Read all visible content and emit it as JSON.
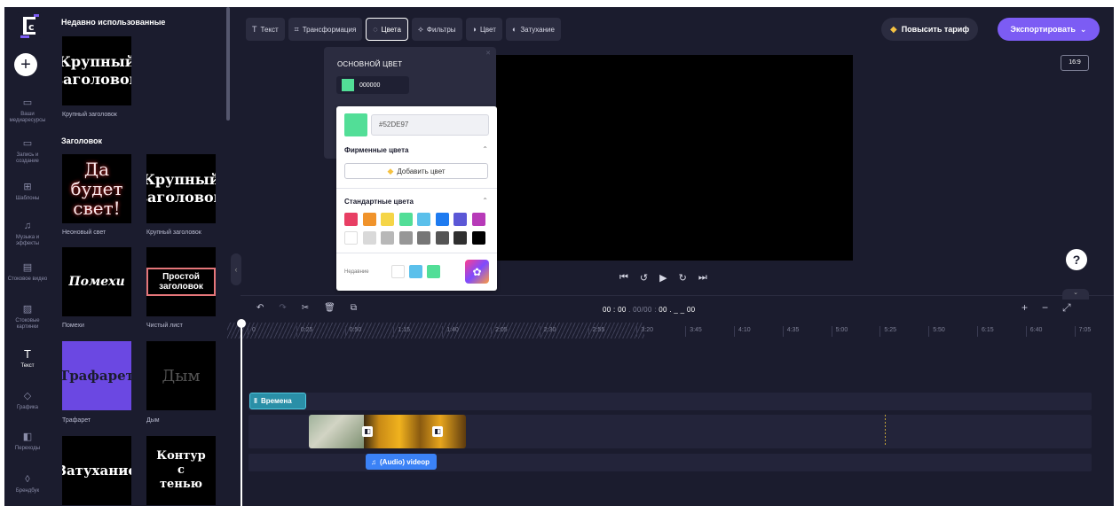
{
  "rail": {
    "items": [
      {
        "label": "Ваши медиаресурсы",
        "icon": "folder-icon"
      },
      {
        "label": "Запись и создание",
        "icon": "camera-icon"
      },
      {
        "label": "Шаблоны",
        "icon": "templates-icon"
      },
      {
        "label": "Музыка и эффекты",
        "icon": "music-icon"
      },
      {
        "label": "Стоковое видео",
        "icon": "film-icon"
      },
      {
        "label": "Стоковые картинки",
        "icon": "image-icon"
      },
      {
        "label": "Текст",
        "icon": "text-icon"
      },
      {
        "label": "Графика",
        "icon": "shapes-icon"
      },
      {
        "label": "Переходы",
        "icon": "transition-icon"
      },
      {
        "label": "Брендбук",
        "icon": "brand-icon"
      }
    ]
  },
  "panel": {
    "recent_title": "Недавно использованные",
    "headings_title": "Заголовок",
    "tiles": [
      {
        "text": "Крупный заголовок",
        "caption": "Крупный заголовок"
      },
      {
        "text": "Да будет свет!",
        "caption": "Неоновый свет"
      },
      {
        "text": "Крупный заголовок",
        "caption": "Крупный заголовок"
      },
      {
        "text": "Помехи",
        "caption": "Помехи"
      },
      {
        "text": "Простой заголовок",
        "caption": "Чистый лист"
      },
      {
        "text": "Трафарет",
        "caption": "Трафарет"
      },
      {
        "text": "Дым",
        "caption": "Дым"
      },
      {
        "text": "Затухание",
        "caption": ""
      },
      {
        "text": "Контур с тенью",
        "caption": ""
      }
    ]
  },
  "toolbar": {
    "tabs": [
      {
        "label": "Текст",
        "icon": "text-icon"
      },
      {
        "label": "Трансформация",
        "icon": "transform-icon"
      },
      {
        "label": "Цвета",
        "icon": "palette-icon"
      },
      {
        "label": "Фильтры",
        "icon": "filters-icon"
      },
      {
        "label": "Цвет",
        "icon": "contrast-icon"
      },
      {
        "label": "Затухание",
        "icon": "fade-icon"
      }
    ],
    "upgrade_label": "Повысить тариф",
    "export_label": "Экспортировать",
    "aspect_ratio": "16:9"
  },
  "color_panel": {
    "title": "ОСНОВНОЙ ЦВЕТ",
    "current_value": "000000"
  },
  "picker": {
    "hex_value": "#52DE97",
    "preview_color": "#52de97",
    "brand_title": "Фирменные цвета",
    "add_color_label": "Добавить цвет",
    "standard_title": "Стандартные цвета",
    "standard_colors": [
      "#e83f64",
      "#f0932b",
      "#f5d547",
      "#52de97",
      "#5bc0eb",
      "#1e7bf0",
      "#5b57d6",
      "#b73ab8",
      "#ffffff",
      "#d9d9d9",
      "#b8b8b8",
      "#979797",
      "#767676",
      "#555555",
      "#2f2f2f",
      "#000000"
    ],
    "recent_label": "Недавние",
    "recent_colors": [
      "#ffffff",
      "#5bc0eb",
      "#52de97"
    ]
  },
  "timeline": {
    "time_current": "00 : 00",
    "time_sep": ". 00/00 :",
    "time_total": "00 . _ _ 00",
    "ticks": [
      "0",
      "0:25",
      "0:50",
      "1:15",
      "1:40",
      "2:05",
      "2:30",
      "2:55",
      "3:20",
      "3:45",
      "4:10",
      "4:35",
      "5:00",
      "5:25",
      "5:50",
      "6:15",
      "6:40",
      "7:05"
    ],
    "text_clip_label": "Времена",
    "audio_clip_label": "(Audio) videop"
  }
}
